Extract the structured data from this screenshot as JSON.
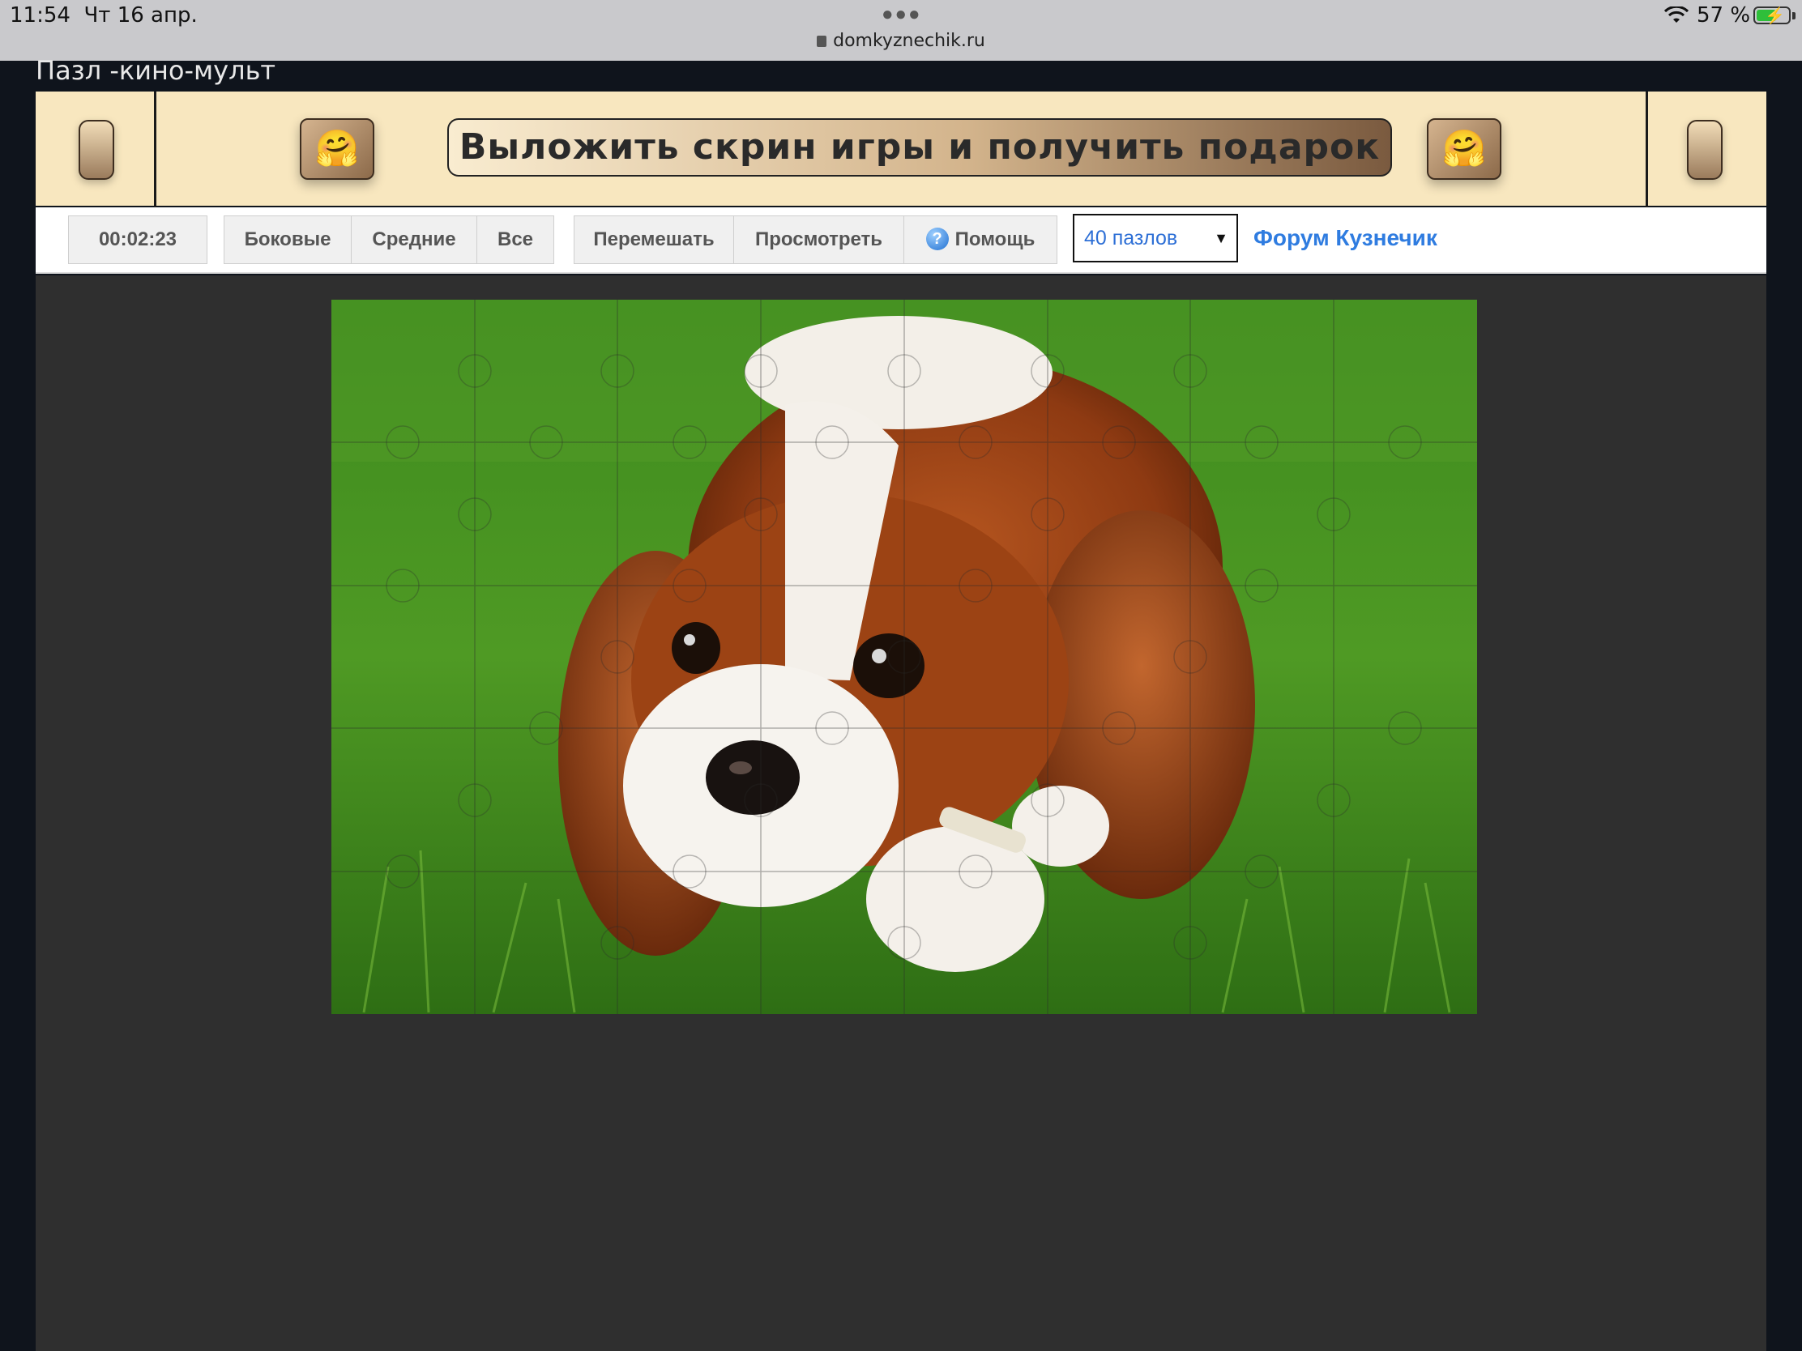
{
  "status_bar": {
    "time": "11:54",
    "date": "Чт 16 апр.",
    "url": "domkyznechik.ru",
    "battery": "57 %"
  },
  "page": {
    "title": "Пазл -кино-мульт"
  },
  "banner": {
    "cta": "Выложить скрин игры и получить подарок",
    "emoji": "🤗",
    "colors": {
      "background": "#f8e7bf",
      "accent": "#8c6a4a"
    }
  },
  "toolbar": {
    "timer": "00:02:23",
    "filter_edges": "Боковые",
    "filter_middle": "Средние",
    "filter_all": "Все",
    "shuffle": "Перемешать",
    "preview": "Просмотреть",
    "help": "Помощь",
    "piece_count": "40 пазлов",
    "forum": "Форум Кузнечик"
  },
  "puzzle": {
    "image_subject": "Cavalier King Charles spaniel puppy lying on grass",
    "grid_cols": 8,
    "grid_rows": 5
  }
}
